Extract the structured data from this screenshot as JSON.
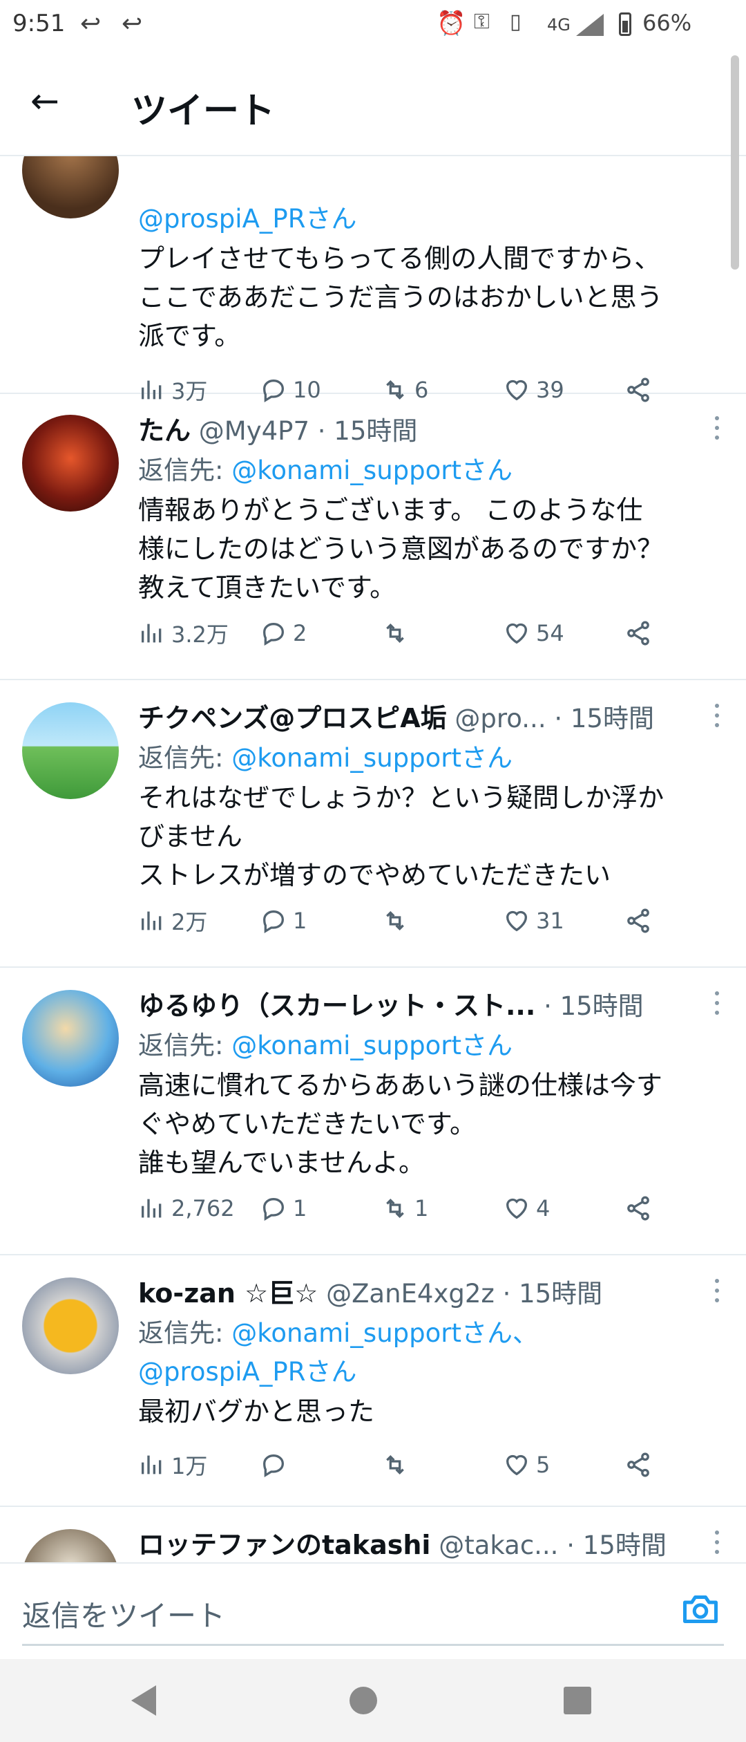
{
  "status_bar": {
    "time": "9:51",
    "icons": [
      "reply-arrow-icon",
      "reply-all-arrow-icon",
      "alarm-icon",
      "key-icon",
      "vibrate-icon",
      "signal-4g-icon",
      "battery-icon"
    ],
    "network": "4G",
    "battery": "66%"
  },
  "header": {
    "title": "ツイート",
    "back_icon": "arrow-left-icon"
  },
  "tweets": [
    {
      "name": "",
      "handle": "",
      "time": "",
      "reply_to_prefix": "",
      "reply_to_handles": "@prospiA_PRさん",
      "body": "プレイさせてもらってる側の人間ですから、\nここでああだこうだ言うのはおかしいと思う\n派です。",
      "views": "3万",
      "replies": "10",
      "retweets": "6",
      "likes": "39"
    },
    {
      "name": "たん",
      "handle": "@My4P7",
      "time": "· 15時間",
      "reply_to_prefix": "返信先: ",
      "reply_to_handles": "@konami_supportさん",
      "body": "情報ありがとうございます。 このような仕\n様にしたのはどういう意図があるのですか？\n教えて頂きたいです。",
      "views": "3.2万",
      "replies": "2",
      "retweets": "",
      "likes": "54"
    },
    {
      "name": "チクペンズ@プロスピA垢",
      "handle": "@pro...",
      "time": "· 15時間",
      "reply_to_prefix": "返信先: ",
      "reply_to_handles": "@konami_supportさん",
      "body": "それはなぜでしょうか？という疑問しか浮か\nびません\nストレスが増すのでやめていただきたい",
      "views": "2万",
      "replies": "1",
      "retweets": "",
      "likes": "31"
    },
    {
      "name": "ゆるゆり（スカーレット・スト...",
      "handle": "",
      "time": "· 15時間",
      "reply_to_prefix": "返信先: ",
      "reply_to_handles": "@konami_supportさん",
      "body": "高速に慣れてるからああいう謎の仕様は今す\nぐやめていただきたいです。\n誰も望んでいませんよ。",
      "views": "2,762",
      "replies": "1",
      "retweets": "1",
      "likes": "4"
    },
    {
      "name": "ko-zan ☆巨☆",
      "handle": "@ZanE4xg2z",
      "time": "· 15時間",
      "reply_to_prefix": "返信先: ",
      "reply_to_handles": "@konami_supportさん、",
      "reply_to_handles_2": "@prospiA_PRさん",
      "body": "最初バグかと思った",
      "views": "1万",
      "replies": "",
      "retweets": "",
      "likes": "5"
    },
    {
      "name": "ロッテファンのtakashi",
      "handle": "@takac...",
      "time": "· 15時間"
    }
  ],
  "compose": {
    "placeholder": "返信をツイート",
    "icon": "camera-icon"
  },
  "nav": {
    "icons": [
      "nav-back-icon",
      "nav-home-icon",
      "nav-recents-icon"
    ]
  },
  "colors": {
    "link": "#1d9bf0",
    "text": "#0f1419",
    "secondary": "#536471",
    "divider": "#e6ecf0"
  }
}
